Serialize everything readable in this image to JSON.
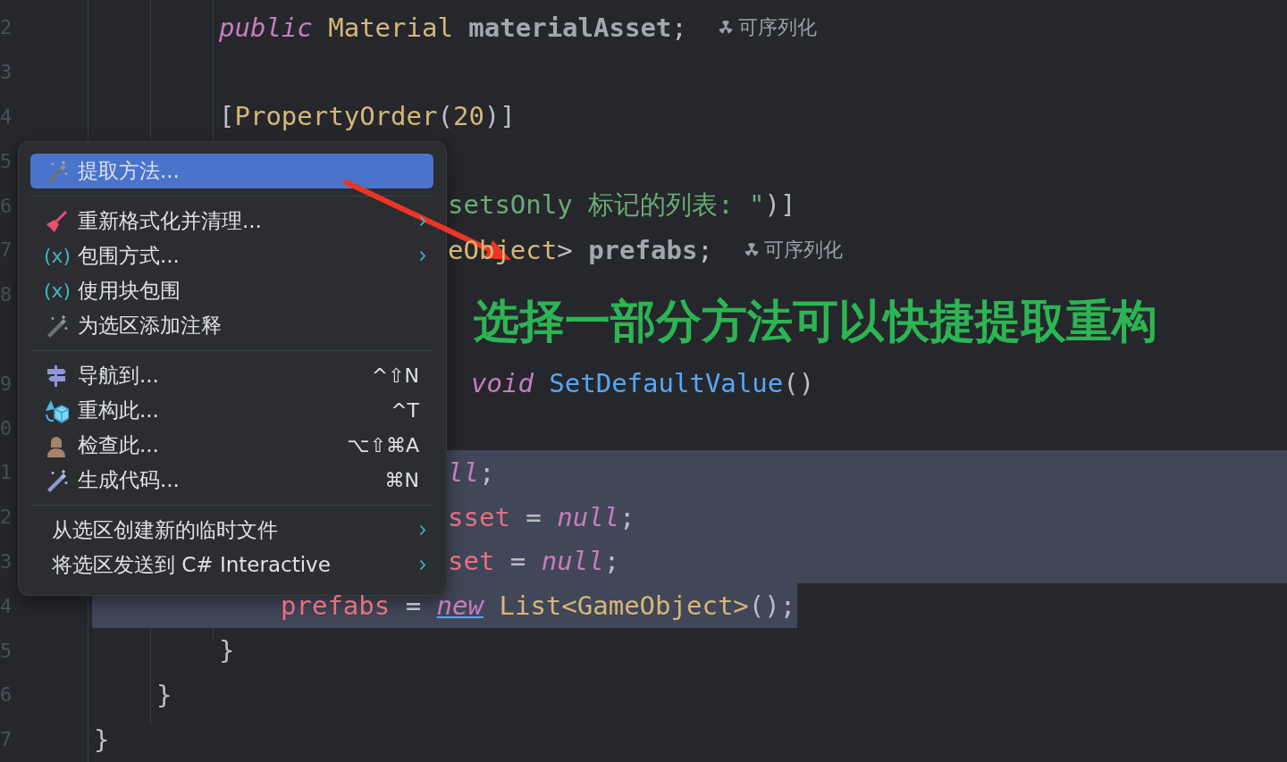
{
  "editor": {
    "lines": [
      {
        "number": "2",
        "tokens": [
          {
            "text": "public ",
            "kind": "keyword"
          },
          {
            "text": "Material ",
            "kind": "type"
          },
          {
            "text": "materialAsset",
            "kind": "unused"
          },
          {
            "text": ";",
            "kind": "punct"
          }
        ],
        "hint": "可序列化",
        "selected": false
      },
      {
        "number": "3",
        "selected": false
      },
      {
        "number": "4",
        "tokens": [
          {
            "text": "[",
            "kind": "punct"
          },
          {
            "text": "PropertyOrder",
            "kind": "type"
          },
          {
            "text": "(",
            "kind": "punct"
          },
          {
            "text": "20",
            "kind": "number"
          },
          {
            "text": ")]",
            "kind": "punct"
          }
        ],
        "selected": false
      },
      {
        "number": "5",
        "selected": false
      },
      {
        "number": "6",
        "tokens": [
          {
            "text": "setsOnly 标记的列表: \"",
            "kind": "string"
          },
          {
            "text": ")]",
            "kind": "punct"
          }
        ],
        "selected": false
      },
      {
        "number": "7",
        "tokens": [
          {
            "text": "eObject",
            "kind": "type"
          },
          {
            "text": "> ",
            "kind": "punct"
          },
          {
            "text": "prefabs",
            "kind": "unused"
          },
          {
            "text": ";",
            "kind": "punct"
          }
        ],
        "hint": "可序列化",
        "selected": false
      },
      {
        "number": "8",
        "selected": false
      },
      {
        "selected": false
      },
      {
        "number": "9",
        "tokens": [
          {
            "text": "void ",
            "kind": "keyword"
          },
          {
            "text": "SetDefaultValue",
            "kind": "method"
          },
          {
            "text": "()",
            "kind": "punct"
          }
        ],
        "selected": false
      },
      {
        "number": "0",
        "selected": false
      },
      {
        "number": "1",
        "tokens": [
          {
            "text": "ll",
            "kind": "keyword"
          },
          {
            "text": ";",
            "kind": "punct"
          }
        ],
        "selected": true
      },
      {
        "number": "2",
        "tokens": [
          {
            "text": "sset",
            "kind": "field"
          },
          {
            "text": " = ",
            "kind": "punct"
          },
          {
            "text": "null",
            "kind": "keyword"
          },
          {
            "text": ";",
            "kind": "punct"
          }
        ],
        "selected": true
      },
      {
        "number": "3",
        "tokens": [
          {
            "text": "set",
            "kind": "field"
          },
          {
            "text": " = ",
            "kind": "punct"
          },
          {
            "text": "null",
            "kind": "keyword"
          },
          {
            "text": ";",
            "kind": "punct"
          }
        ],
        "selected": true
      },
      {
        "number": "4",
        "tokens": [
          {
            "text": "prefabs",
            "kind": "field"
          },
          {
            "text": " = ",
            "kind": "punct"
          },
          {
            "text": "new",
            "kind": "link"
          },
          {
            "text": " List<GameObject>",
            "kind": "type"
          },
          {
            "text": "();",
            "kind": "punct"
          }
        ],
        "selected": true,
        "partial": true
      },
      {
        "number": "5",
        "tokens": [
          {
            "text": "}",
            "kind": "punct"
          }
        ],
        "selected": false
      },
      {
        "number": "6",
        "tokens": [
          {
            "text": "}",
            "kind": "punct"
          }
        ],
        "selected": false
      },
      {
        "number": "7",
        "tokens": [
          {
            "text": "}",
            "kind": "punct"
          }
        ],
        "selected": false
      }
    ]
  },
  "context_menu": {
    "groups": [
      {
        "items": [
          {
            "label": "提取方法...",
            "selected": true,
            "submenu": false
          }
        ]
      },
      {
        "items": [
          {
            "label": "重新格式化并清理...",
            "selected": false,
            "submenu": true
          },
          {
            "label": "包围方式...",
            "glyph": "(x)",
            "selected": false,
            "submenu": true
          },
          {
            "label": "使用块包围",
            "glyph": "(x)",
            "selected": false,
            "submenu": false
          },
          {
            "label": "为选区添加注释",
            "selected": false,
            "submenu": false
          }
        ]
      },
      {
        "items": [
          {
            "label": "导航到...",
            "shortcut": "^⇧N",
            "selected": false,
            "submenu": false
          },
          {
            "label": "重构此...",
            "shortcut": "^T",
            "selected": false,
            "submenu": false
          },
          {
            "label": "检查此...",
            "shortcut": "⌥⇧⌘A",
            "selected": false,
            "submenu": false
          },
          {
            "label": "生成代码...",
            "shortcut": "⌘N",
            "selected": false,
            "submenu": false
          }
        ]
      },
      {
        "items": [
          {
            "label": "从选区创建新的临时文件",
            "selected": false,
            "submenu": true
          },
          {
            "label": "将选区发送到 C# Interactive",
            "selected": false,
            "submenu": true
          }
        ]
      }
    ]
  },
  "annotation": {
    "text": "选择一部分方法可以快捷提取重构"
  }
}
